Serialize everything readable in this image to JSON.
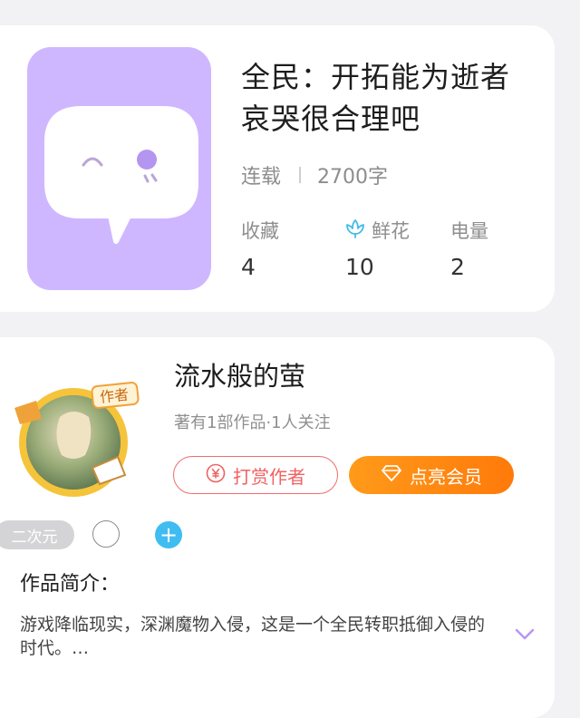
{
  "book": {
    "title": "全民：开拓能为逝者哀哭很合理吧",
    "status": "连载",
    "word_count": "2700字",
    "stats": [
      {
        "label": "收藏",
        "value": "4"
      },
      {
        "label": "鲜花",
        "value": "10",
        "icon": "flower-icon"
      },
      {
        "label": "电量",
        "value": "2"
      }
    ],
    "cover_color": "#cfb7ff"
  },
  "author": {
    "name": "流水般的萤",
    "meta": "著有1部作品·1人关注",
    "badge_text": "作者",
    "tip_button": "打赏作者",
    "vip_button": "点亮会员",
    "tip_color": "#f06262",
    "vip_color": "#ff8a12"
  },
  "tags": {
    "items": [
      "二次元"
    ],
    "add_icon": "plus-icon"
  },
  "intro": {
    "heading": "作品简介：",
    "text": "游戏降临现实，深渊魔物入侵，这是一个全民转职抵御入侵的时代。…",
    "expand_icon": "chevron-down-icon"
  }
}
